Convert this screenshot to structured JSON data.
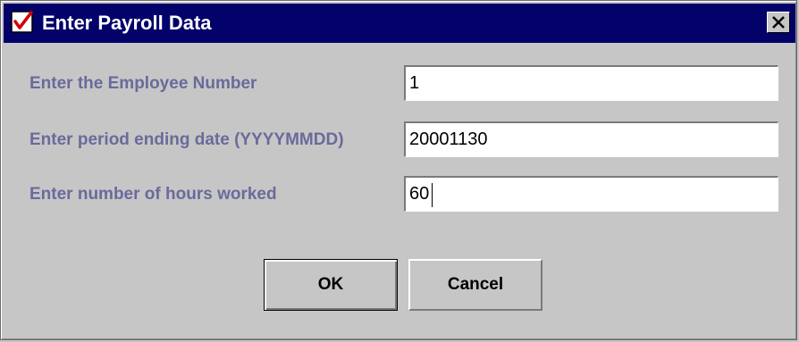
{
  "window": {
    "title": "Enter Payroll Data",
    "app_icon": "checkbox-check-icon",
    "close_icon": "close-x-icon"
  },
  "form": {
    "fields": [
      {
        "label": "Enter the Employee Number",
        "value": "1"
      },
      {
        "label": "Enter period ending date (YYYYMMDD)",
        "value": "20001130"
      },
      {
        "label": "Enter number of hours worked",
        "value": "60"
      }
    ]
  },
  "buttons": {
    "ok_label": "OK",
    "cancel_label": "Cancel"
  },
  "colors": {
    "titlebar": "#02026a",
    "label_text": "#6a6a9c",
    "dialog_background": "#c6c6c6"
  }
}
